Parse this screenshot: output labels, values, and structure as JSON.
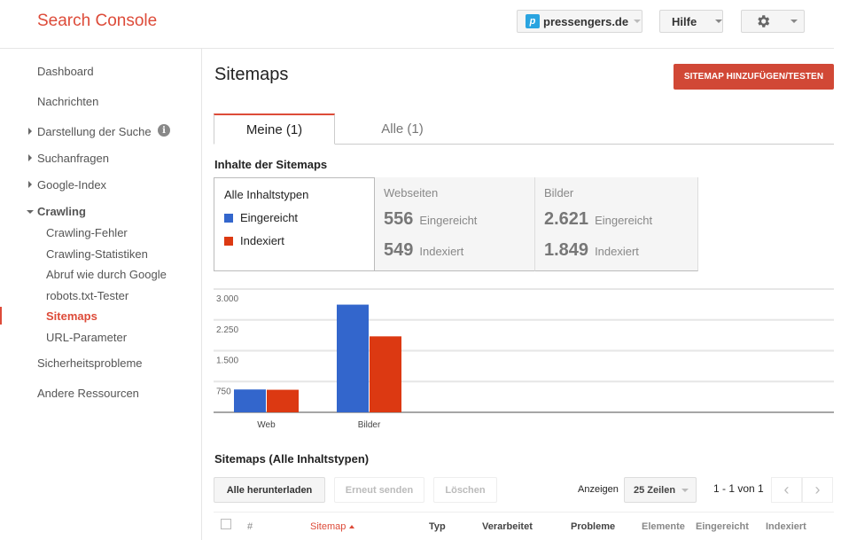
{
  "header": {
    "app_title": "Search Console",
    "site_selector": {
      "label": "pressengers.de",
      "icon": "site-favicon-icon"
    },
    "help_label": "Hilfe",
    "settings_icon": "gear-icon"
  },
  "sidebar": {
    "items": [
      {
        "label": "Dashboard",
        "expandable": false
      },
      {
        "label": "Nachrichten",
        "expandable": false
      },
      {
        "label": "Darstellung der Suche",
        "expandable": true,
        "info_icon": true
      },
      {
        "label": "Suchanfragen",
        "expandable": true
      },
      {
        "label": "Google-Index",
        "expandable": true
      },
      {
        "label": "Crawling",
        "expandable": true,
        "expanded": true,
        "children": [
          {
            "label": "Crawling-Fehler"
          },
          {
            "label": "Crawling-Statistiken"
          },
          {
            "label": "Abruf wie durch Google"
          },
          {
            "label": "robots.txt-Tester"
          },
          {
            "label": "Sitemaps",
            "active": true
          },
          {
            "label": "URL-Parameter"
          }
        ]
      },
      {
        "label": "Sicherheitsprobleme",
        "expandable": false
      },
      {
        "label": "Andere Ressourcen",
        "expandable": false
      }
    ]
  },
  "main": {
    "title": "Sitemaps",
    "add_button": "SITEMAP HINZUFÜGEN/TESTEN",
    "tabs": [
      {
        "label": "Meine (1)",
        "active": true
      },
      {
        "label": "Alle (1)",
        "active": false
      }
    ],
    "contents_heading": "Inhalte der Sitemaps",
    "legend": {
      "title": "Alle Inhaltstypen",
      "items": [
        {
          "label": "Eingereicht",
          "color": "#3366cc"
        },
        {
          "label": "Indexiert",
          "color": "#dc3912"
        }
      ]
    },
    "stats": [
      {
        "title": "Webseiten",
        "submitted": "556",
        "submitted_label": "Eingereicht",
        "indexed": "549",
        "indexed_label": "Indexiert"
      },
      {
        "title": "Bilder",
        "submitted": "2.621",
        "submitted_label": "Eingereicht",
        "indexed": "1.849",
        "indexed_label": "Indexiert"
      }
    ],
    "table_heading": "Sitemaps (Alle Inhaltstypen)",
    "buttons": {
      "download_all": "Alle herunterladen",
      "resend": "Erneut senden",
      "delete": "Löschen"
    },
    "show_label": "Anzeigen",
    "rows_select": "25 Zeilen",
    "pagination": "1 - 1 von 1",
    "columns": [
      "#",
      "Sitemap",
      "Typ",
      "Verarbeitet",
      "Probleme",
      "Elemente",
      "Eingereicht",
      "Indexiert"
    ]
  },
  "chart_data": {
    "type": "bar",
    "categories": [
      "Web",
      "Bilder"
    ],
    "series": [
      {
        "name": "Eingereicht",
        "color": "#3366cc",
        "values": [
          556,
          2621
        ]
      },
      {
        "name": "Indexiert",
        "color": "#dc3912",
        "values": [
          549,
          1849
        ]
      }
    ],
    "yticks": [
      750,
      1500,
      2250,
      3000
    ],
    "ytick_labels": [
      "750",
      "1.500",
      "2.250",
      "3.000"
    ],
    "ylim": [
      0,
      3000
    ],
    "grid": true,
    "title": "",
    "xlabel": "",
    "ylabel": ""
  }
}
